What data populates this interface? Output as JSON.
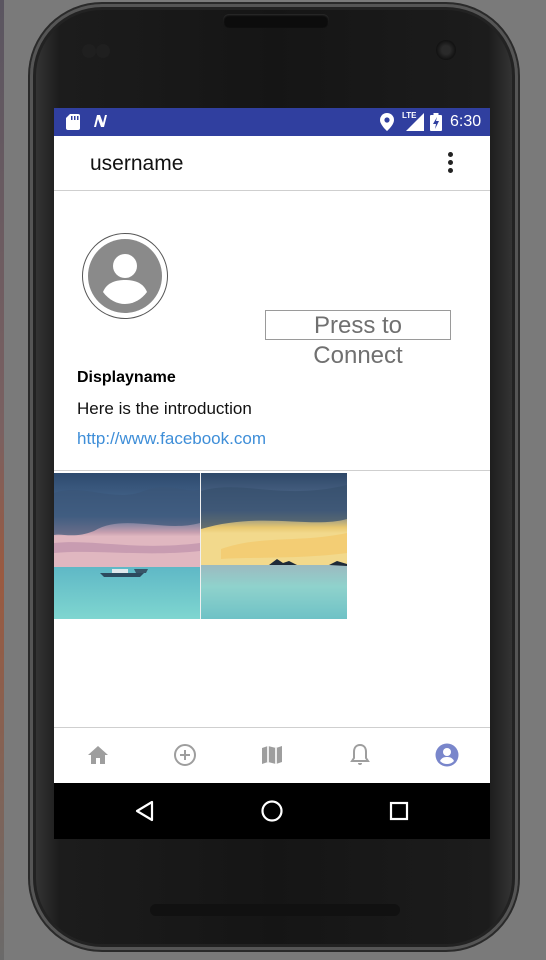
{
  "statusbar": {
    "time": "6:30",
    "network_label": "LTE",
    "icons": [
      "sd-card-icon",
      "n-notification-icon",
      "location-icon",
      "lte-signal-icon",
      "battery-charging-icon"
    ]
  },
  "appbar": {
    "title": "username",
    "menu_icon": "more-vert-icon"
  },
  "profile": {
    "avatar_icon": "account-circle-icon",
    "connect_label": "Press to Connect",
    "displayname": "Displayname",
    "introduction": "Here is the introduction",
    "link": "http://www.facebook.com"
  },
  "gallery": {
    "images": [
      "beach-boat-photo",
      "sunset-island-photo"
    ]
  },
  "bottom_nav": {
    "items": [
      {
        "icon": "home-icon",
        "active": false
      },
      {
        "icon": "add-circle-icon",
        "active": false
      },
      {
        "icon": "map-icon",
        "active": false
      },
      {
        "icon": "bell-icon",
        "active": false
      },
      {
        "icon": "profile-icon",
        "active": true
      }
    ],
    "colors": {
      "inactive": "#9e9e9e",
      "active": "#7986cb"
    }
  },
  "system_nav": {
    "icons": [
      "back-icon",
      "home-circle-icon",
      "recents-icon"
    ]
  },
  "colors": {
    "statusbar": "#303f9f",
    "link": "#3e8ed8"
  }
}
